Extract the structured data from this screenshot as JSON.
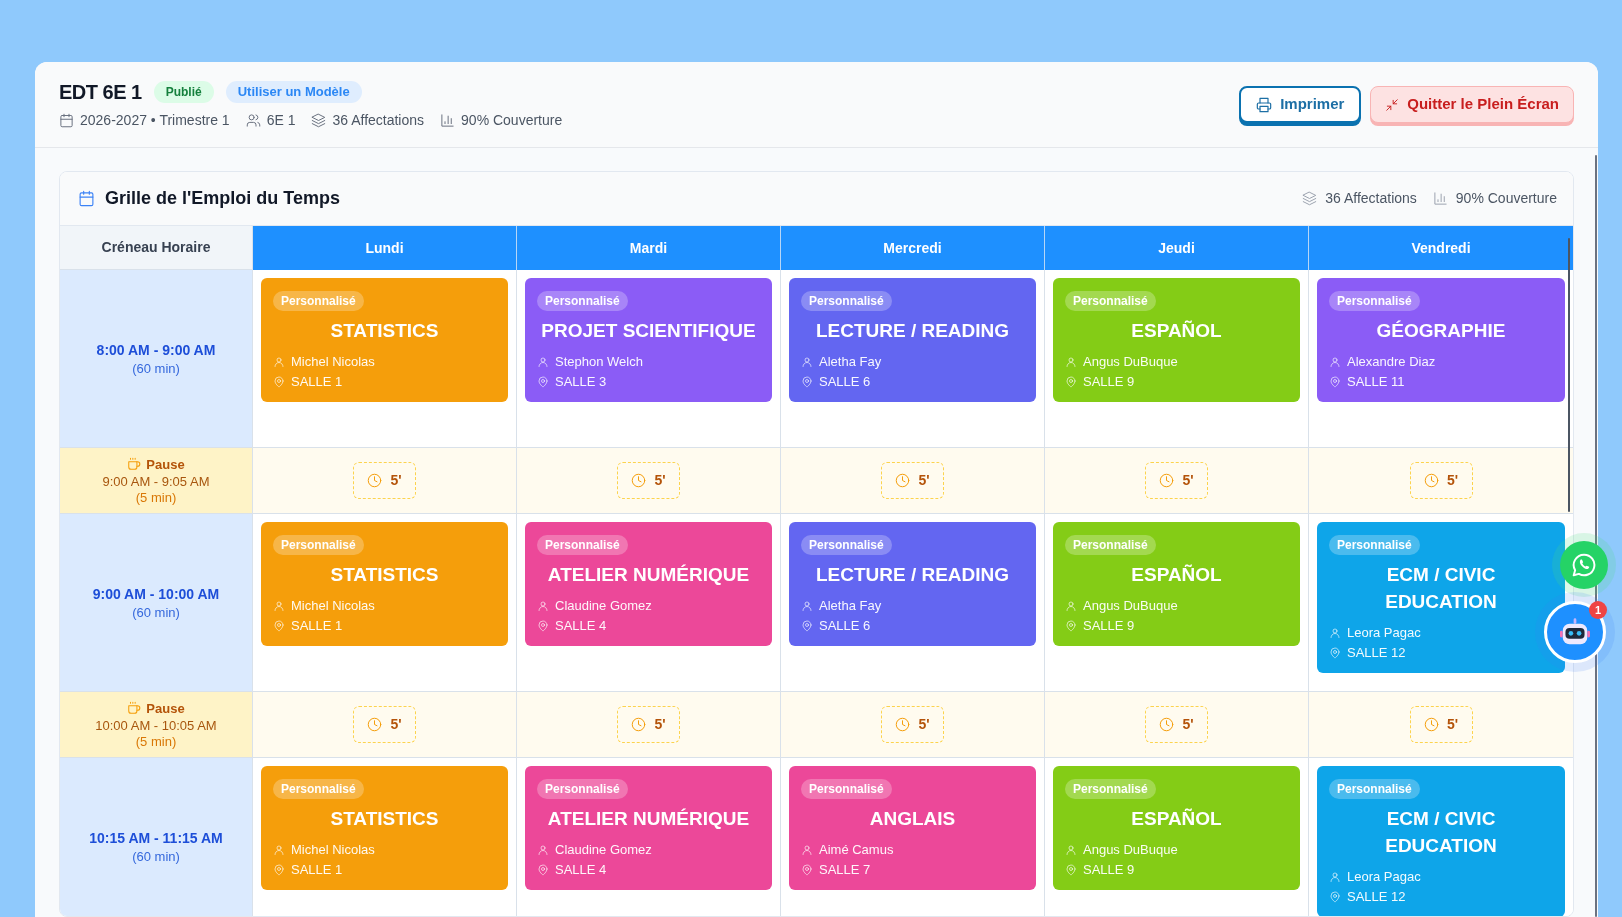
{
  "header": {
    "title": "EDT 6E 1",
    "status_badge": "Publié",
    "template_button": "Utiliser un Modèle",
    "meta": [
      {
        "kind": "period",
        "text": "2026-2027 • Trimestre 1"
      },
      {
        "kind": "class",
        "text": "6E 1"
      },
      {
        "kind": "assignments",
        "text": "36 Affectations"
      },
      {
        "kind": "coverage",
        "text": "90% Couverture"
      }
    ],
    "buttons": [
      {
        "kind": "print",
        "label": "Imprimer"
      },
      {
        "kind": "exit_fullscreen",
        "label": "Quitter le Plein Écran"
      }
    ]
  },
  "grid": {
    "title": "Grille de l'Emploi du Temps",
    "stats": [
      {
        "kind": "assignments",
        "text": "36 Affectations"
      },
      {
        "kind": "coverage",
        "text": "90% Couverture"
      }
    ],
    "time_column_header": "Créneau Horaire",
    "days": [
      "Lundi",
      "Mardi",
      "Mercredi",
      "Jeudi",
      "Vendredi"
    ],
    "rows": [
      {
        "kind": "lesson",
        "time": "8:00 AM - 9:00 AM",
        "duration": "(60 min)",
        "cells": [
          {
            "badge": "Personnalisé",
            "subject": "STATISTICS",
            "teacher": "Michel Nicolas",
            "room": "SALLE 1",
            "color": "#f59e0b"
          },
          {
            "badge": "Personnalisé",
            "subject": "PROJET SCIENTIFIQUE",
            "teacher": "Stephon Welch",
            "room": "SALLE 3",
            "color": "#8b5cf6"
          },
          {
            "badge": "Personnalisé",
            "subject": "LECTURE / READING",
            "teacher": "Aletha Fay",
            "room": "SALLE 6",
            "color": "#6366f1"
          },
          {
            "badge": "Personnalisé",
            "subject": "ESPAÑOL",
            "teacher": "Angus DuBuque",
            "room": "SALLE 9",
            "color": "#84cc16"
          },
          {
            "badge": "Personnalisé",
            "subject": "GÉOGRAPHIE",
            "teacher": "Alexandre Diaz",
            "room": "SALLE 11",
            "color": "#8b5cf6"
          }
        ]
      },
      {
        "kind": "break",
        "label": "Pause",
        "time": "9:00 AM - 9:05 AM",
        "duration": "(5 min)",
        "cells": [
          "5'",
          "5'",
          "5'",
          "5'",
          "5'"
        ]
      },
      {
        "kind": "lesson",
        "time": "9:00 AM - 10:00 AM",
        "duration": "(60 min)",
        "cells": [
          {
            "badge": "Personnalisé",
            "subject": "STATISTICS",
            "teacher": "Michel Nicolas",
            "room": "SALLE 1",
            "color": "#f59e0b"
          },
          {
            "badge": "Personnalisé",
            "subject": "ATELIER NUMÉRIQUE",
            "teacher": "Claudine Gomez",
            "room": "SALLE 4",
            "color": "#ec4899"
          },
          {
            "badge": "Personnalisé",
            "subject": "LECTURE / READING",
            "teacher": "Aletha Fay",
            "room": "SALLE 6",
            "color": "#6366f1"
          },
          {
            "badge": "Personnalisé",
            "subject": "ESPAÑOL",
            "teacher": "Angus DuBuque",
            "room": "SALLE 9",
            "color": "#84cc16"
          },
          {
            "badge": "Personnalisé",
            "subject": "ECM / CIVIC EDUCATION",
            "teacher": "Leora Pagac",
            "room": "SALLE 12",
            "color": "#0ea5e9"
          }
        ]
      },
      {
        "kind": "break",
        "label": "Pause",
        "time": "10:00 AM - 10:05 AM",
        "duration": "(5 min)",
        "cells": [
          "5'",
          "5'",
          "5'",
          "5'",
          "5'"
        ]
      },
      {
        "kind": "lesson",
        "time": "10:15 AM - 11:15 AM",
        "duration": "(60 min)",
        "cells": [
          {
            "badge": "Personnalisé",
            "subject": "STATISTICS",
            "teacher": "Michel Nicolas",
            "room": "SALLE 1",
            "color": "#f59e0b"
          },
          {
            "badge": "Personnalisé",
            "subject": "ATELIER NUMÉRIQUE",
            "teacher": "Claudine Gomez",
            "room": "SALLE 4",
            "color": "#ec4899"
          },
          {
            "badge": "Personnalisé",
            "subject": "ANGLAIS",
            "teacher": "Aimé Camus",
            "room": "SALLE 7",
            "color": "#ec4899"
          },
          {
            "badge": "Personnalisé",
            "subject": "ESPAÑOL",
            "teacher": "Angus DuBuque",
            "room": "SALLE 9",
            "color": "#84cc16"
          },
          {
            "badge": "Personnalisé",
            "subject": "ECM / CIVIC EDUCATION",
            "teacher": "Leora Pagac",
            "room": "SALLE 12",
            "color": "#0ea5e9"
          }
        ]
      }
    ]
  },
  "assistant_button": {
    "badge": "1"
  }
}
